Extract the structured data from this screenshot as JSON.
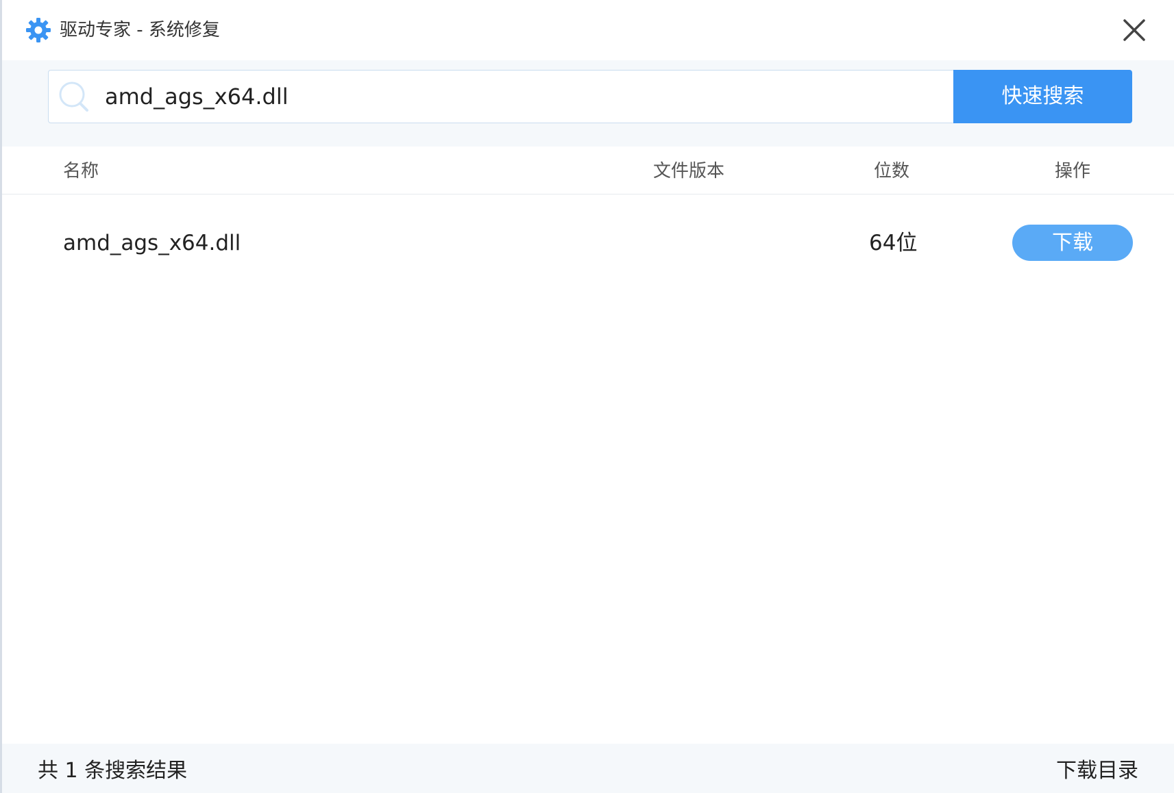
{
  "window": {
    "title": "驱动专家 - 系统修复",
    "app_icon": "gear-icon",
    "close_icon": "close-icon"
  },
  "search": {
    "icon": "search-icon",
    "value": "amd_ags_x64.dll",
    "button_label": "快速搜索"
  },
  "table": {
    "headers": {
      "name": "名称",
      "version": "文件版本",
      "bits": "位数",
      "action": "操作"
    },
    "rows": [
      {
        "name": "amd_ags_x64.dll",
        "version": "",
        "bits": "64位",
        "action_label": "下载"
      }
    ]
  },
  "footer": {
    "result_count": "共 1 条搜索结果",
    "download_dir": "下载目录"
  },
  "colors": {
    "accent": "#3a94f3",
    "download_button": "#5aaaf6",
    "band_background": "#f5f8fb"
  }
}
